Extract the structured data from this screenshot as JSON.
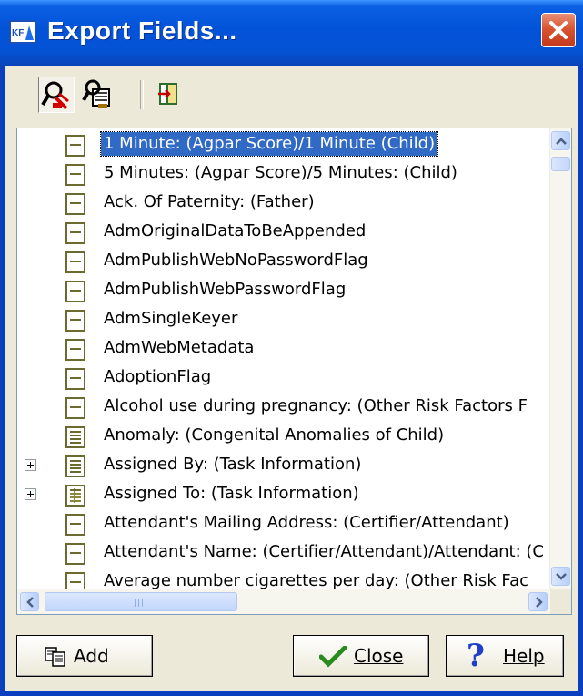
{
  "window": {
    "title": "Export Fields..."
  },
  "toolbar": {
    "buttons": [
      "find-icon",
      "find-next-icon",
      "insert-field-icon"
    ]
  },
  "fields": [
    {
      "label": "1 Minute: (Agpar Score)/1 Minute (Child)",
      "selected": true,
      "expandable": false,
      "icon": "single"
    },
    {
      "label": "5 Minutes: (Agpar Score)/5 Minutes: (Child)",
      "selected": false,
      "expandable": false,
      "icon": "single"
    },
    {
      "label": "Ack. Of Paternity: (Father)",
      "selected": false,
      "expandable": false,
      "icon": "single"
    },
    {
      "label": "AdmOriginalDataToBeAppended",
      "selected": false,
      "expandable": false,
      "icon": "single"
    },
    {
      "label": "AdmPublishWebNoPasswordFlag",
      "selected": false,
      "expandable": false,
      "icon": "single"
    },
    {
      "label": "AdmPublishWebPasswordFlag",
      "selected": false,
      "expandable": false,
      "icon": "single"
    },
    {
      "label": "AdmSingleKeyer",
      "selected": false,
      "expandable": false,
      "icon": "single"
    },
    {
      "label": "AdmWebMetadata",
      "selected": false,
      "expandable": false,
      "icon": "single"
    },
    {
      "label": "AdoptionFlag",
      "selected": false,
      "expandable": false,
      "icon": "single"
    },
    {
      "label": "Alcohol use during pregnancy: (Other Risk Factors F",
      "selected": false,
      "expandable": false,
      "icon": "single"
    },
    {
      "label": "Anomaly: (Congenital Anomalies of Child)",
      "selected": false,
      "expandable": false,
      "icon": "multi"
    },
    {
      "label": "Assigned By: (Task Information)",
      "selected": false,
      "expandable": true,
      "icon": "multi"
    },
    {
      "label": "Assigned To: (Task Information)",
      "selected": false,
      "expandable": true,
      "icon": "table"
    },
    {
      "label": "Attendant's Mailing Address: (Certifier/Attendant)",
      "selected": false,
      "expandable": false,
      "icon": "single"
    },
    {
      "label": "Attendant's Name: (Certifier/Attendant)/Attendant: (C",
      "selected": false,
      "expandable": false,
      "icon": "single"
    },
    {
      "label": "Average number cigarettes per day: (Other Risk Fac",
      "selected": false,
      "expandable": false,
      "icon": "single"
    }
  ],
  "buttons": {
    "add": "Add",
    "close": "Close",
    "help": "Help"
  },
  "colors": {
    "selection": "#316ac5",
    "titlebar": "#0353d8",
    "face": "#ece9d8"
  }
}
